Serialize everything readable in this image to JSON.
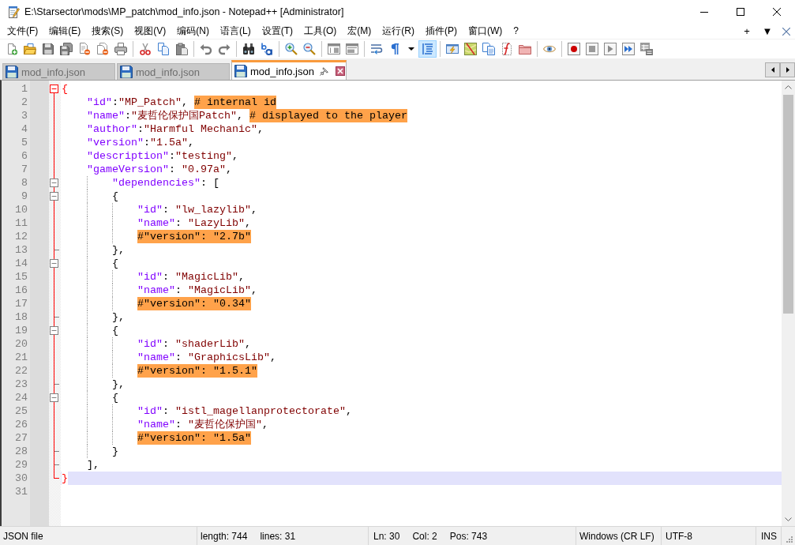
{
  "window": {
    "title": "E:\\Starsector\\mods\\MP_patch\\mod_info.json - Notepad++ [Administrator]"
  },
  "menu_bar": {
    "items": [
      "文件(F)",
      "编辑(E)",
      "搜索(S)",
      "视图(V)",
      "编码(N)",
      "语言(L)",
      "设置(T)",
      "工具(O)",
      "宏(M)",
      "运行(R)",
      "插件(P)",
      "窗口(W)",
      "?"
    ],
    "right_buttons": [
      "+",
      "▼"
    ]
  },
  "toolbar": {
    "indent_guide_on": true
  },
  "tabs": [
    {
      "label": "mod_info.json",
      "selected": false
    },
    {
      "label": "mod_info.json",
      "selected": false
    },
    {
      "label": "mod_info.json",
      "selected": true
    }
  ],
  "editor": {
    "lines": [
      {
        "number": "1",
        "kind": "header",
        "current": false,
        "fold_active": true,
        "segments": [
          {
            "kind": "brace_match",
            "text": "{"
          }
        ]
      },
      {
        "number": "2",
        "kind": "body",
        "current": false,
        "segments": [
          {
            "kind": "key",
            "text": "    \"id\""
          },
          {
            "kind": "punct",
            "text": ":"
          },
          {
            "kind": "string",
            "text": "\"MP_Patch\""
          },
          {
            "kind": "punct",
            "text": ", "
          },
          {
            "kind": "comment",
            "text": "# internal id"
          }
        ]
      },
      {
        "number": "3",
        "kind": "body",
        "current": false,
        "segments": [
          {
            "kind": "key",
            "text": "    \"name\""
          },
          {
            "kind": "punct",
            "text": ":"
          },
          {
            "kind": "string",
            "text": "\"麦哲伦保护国Patch\""
          },
          {
            "kind": "punct",
            "text": ", "
          },
          {
            "kind": "comment",
            "text": "# displayed to the player"
          }
        ]
      },
      {
        "number": "4",
        "kind": "body",
        "current": false,
        "segments": [
          {
            "kind": "key",
            "text": "    \"author\""
          },
          {
            "kind": "punct",
            "text": ":"
          },
          {
            "kind": "string",
            "text": "\"Harmful Mechanic\""
          },
          {
            "kind": "punct",
            "text": ","
          }
        ]
      },
      {
        "number": "5",
        "kind": "body",
        "current": false,
        "segments": [
          {
            "kind": "key",
            "text": "    \"version\""
          },
          {
            "kind": "punct",
            "text": ":"
          },
          {
            "kind": "string",
            "text": "\"1.5a\""
          },
          {
            "kind": "punct",
            "text": ","
          }
        ]
      },
      {
        "number": "6",
        "kind": "body",
        "current": false,
        "segments": [
          {
            "kind": "key",
            "text": "    \"description\""
          },
          {
            "kind": "punct",
            "text": ":"
          },
          {
            "kind": "string",
            "text": "\"testing\""
          },
          {
            "kind": "punct",
            "text": ","
          }
        ]
      },
      {
        "number": "7",
        "kind": "body",
        "current": false,
        "segments": [
          {
            "kind": "key",
            "text": "    \"gameVersion\""
          },
          {
            "kind": "punct",
            "text": ": "
          },
          {
            "kind": "string",
            "text": "\"0.97a\""
          },
          {
            "kind": "punct",
            "text": ","
          }
        ]
      },
      {
        "number": "8",
        "kind": "header",
        "current": false,
        "fold_active": false,
        "segments": [
          {
            "kind": "key",
            "text": "        \"dependencies\""
          },
          {
            "kind": "punct",
            "text": ": ["
          }
        ]
      },
      {
        "number": "9",
        "kind": "header",
        "current": false,
        "fold_active": false,
        "segments": [
          {
            "kind": "punct",
            "text": "        {"
          }
        ]
      },
      {
        "number": "10",
        "kind": "body",
        "current": false,
        "segments": [
          {
            "kind": "key",
            "text": "            \"id\""
          },
          {
            "kind": "punct",
            "text": ": "
          },
          {
            "kind": "string",
            "text": "\"lw_lazylib\""
          },
          {
            "kind": "punct",
            "text": ","
          }
        ]
      },
      {
        "number": "11",
        "kind": "body",
        "current": false,
        "segments": [
          {
            "kind": "key",
            "text": "            \"name\""
          },
          {
            "kind": "punct",
            "text": ": "
          },
          {
            "kind": "string",
            "text": "\"LazyLib\""
          },
          {
            "kind": "punct",
            "text": ","
          }
        ]
      },
      {
        "number": "12",
        "kind": "body",
        "current": false,
        "segments": [
          {
            "kind": "comment",
            "text": "            #\"version\": \"2.7b\""
          }
        ]
      },
      {
        "number": "13",
        "kind": "footer",
        "current": false,
        "fold_active": false,
        "segments": [
          {
            "kind": "punct",
            "text": "        },"
          }
        ]
      },
      {
        "number": "14",
        "kind": "header",
        "current": false,
        "fold_active": false,
        "segments": [
          {
            "kind": "punct",
            "text": "        {"
          }
        ]
      },
      {
        "number": "15",
        "kind": "body",
        "current": false,
        "segments": [
          {
            "kind": "key",
            "text": "            \"id\""
          },
          {
            "kind": "punct",
            "text": ": "
          },
          {
            "kind": "string",
            "text": "\"MagicLib\""
          },
          {
            "kind": "punct",
            "text": ","
          }
        ]
      },
      {
        "number": "16",
        "kind": "body",
        "current": false,
        "segments": [
          {
            "kind": "key",
            "text": "            \"name\""
          },
          {
            "kind": "punct",
            "text": ": "
          },
          {
            "kind": "string",
            "text": "\"MagicLib\""
          },
          {
            "kind": "punct",
            "text": ","
          }
        ]
      },
      {
        "number": "17",
        "kind": "body",
        "current": false,
        "segments": [
          {
            "kind": "comment",
            "text": "            #\"version\": \"0.34\""
          }
        ]
      },
      {
        "number": "18",
        "kind": "footer",
        "current": false,
        "fold_active": false,
        "segments": [
          {
            "kind": "punct",
            "text": "        },"
          }
        ]
      },
      {
        "number": "19",
        "kind": "header",
        "current": false,
        "fold_active": false,
        "segments": [
          {
            "kind": "punct",
            "text": "        {"
          }
        ]
      },
      {
        "number": "20",
        "kind": "body",
        "current": false,
        "segments": [
          {
            "kind": "key",
            "text": "            \"id\""
          },
          {
            "kind": "punct",
            "text": ": "
          },
          {
            "kind": "string",
            "text": "\"shaderLib\""
          },
          {
            "kind": "punct",
            "text": ","
          }
        ]
      },
      {
        "number": "21",
        "kind": "body",
        "current": false,
        "segments": [
          {
            "kind": "key",
            "text": "            \"name\""
          },
          {
            "kind": "punct",
            "text": ": "
          },
          {
            "kind": "string",
            "text": "\"GraphicsLib\""
          },
          {
            "kind": "punct",
            "text": ","
          }
        ]
      },
      {
        "number": "22",
        "kind": "body",
        "current": false,
        "segments": [
          {
            "kind": "comment",
            "text": "            #\"version\": \"1.5.1\""
          }
        ]
      },
      {
        "number": "23",
        "kind": "footer",
        "current": false,
        "fold_active": false,
        "segments": [
          {
            "kind": "punct",
            "text": "        },"
          }
        ]
      },
      {
        "number": "24",
        "kind": "header",
        "current": false,
        "fold_active": false,
        "segments": [
          {
            "kind": "punct",
            "text": "        {"
          }
        ]
      },
      {
        "number": "25",
        "kind": "body",
        "current": false,
        "segments": [
          {
            "kind": "key",
            "text": "            \"id\""
          },
          {
            "kind": "punct",
            "text": ": "
          },
          {
            "kind": "string",
            "text": "\"istl_magellanprotectorate\""
          },
          {
            "kind": "punct",
            "text": ","
          }
        ]
      },
      {
        "number": "26",
        "kind": "body",
        "current": false,
        "segments": [
          {
            "kind": "key",
            "text": "            \"name\""
          },
          {
            "kind": "punct",
            "text": ": "
          },
          {
            "kind": "string",
            "text": "\"麦哲伦保护国\""
          },
          {
            "kind": "punct",
            "text": ","
          }
        ]
      },
      {
        "number": "27",
        "kind": "body",
        "current": false,
        "segments": [
          {
            "kind": "comment",
            "text": "            #\"version\": \"1.5a\""
          }
        ]
      },
      {
        "number": "28",
        "kind": "footer",
        "current": false,
        "fold_active": false,
        "segments": [
          {
            "kind": "punct",
            "text": "        }"
          }
        ]
      },
      {
        "number": "29",
        "kind": "footer",
        "current": false,
        "fold_active": false,
        "segments": [
          {
            "kind": "punct",
            "text": "    ],"
          }
        ]
      },
      {
        "number": "30",
        "kind": "footer",
        "current": true,
        "fold_active": true,
        "segments": [
          {
            "kind": "brace_match",
            "text": "}"
          }
        ]
      },
      {
        "number": "31",
        "kind": "body",
        "current": false
      }
    ]
  },
  "status_bar": {
    "file_type": "JSON file",
    "length": "length: 744",
    "lines": "lines: 31",
    "line": "Ln: 30",
    "column": "Col: 2",
    "position": "Pos: 743",
    "line_ending": "Windows (CR LF)",
    "encoding": "UTF-8",
    "insert_mode": "INS"
  }
}
